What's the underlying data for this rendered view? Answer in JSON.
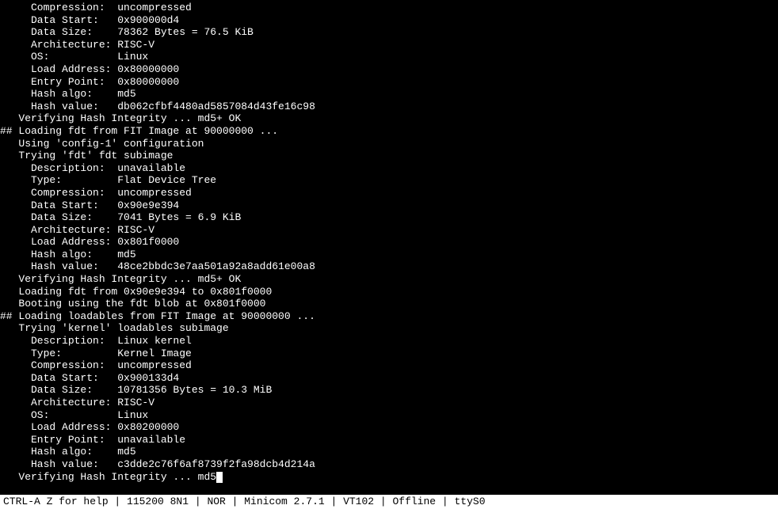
{
  "lines": [
    "     Compression:  uncompressed",
    "     Data Start:   0x900000d4",
    "     Data Size:    78362 Bytes = 76.5 KiB",
    "     Architecture: RISC-V",
    "     OS:           Linux",
    "     Load Address: 0x80000000",
    "     Entry Point:  0x80000000",
    "     Hash algo:    md5",
    "     Hash value:   db062cfbf4480ad5857084d43fe16c98",
    "   Verifying Hash Integrity ... md5+ OK",
    "## Loading fdt from FIT Image at 90000000 ...",
    "   Using 'config-1' configuration",
    "   Trying 'fdt' fdt subimage",
    "     Description:  unavailable",
    "     Type:         Flat Device Tree",
    "     Compression:  uncompressed",
    "     Data Start:   0x90e9e394",
    "     Data Size:    7041 Bytes = 6.9 KiB",
    "     Architecture: RISC-V",
    "     Load Address: 0x801f0000",
    "     Hash algo:    md5",
    "     Hash value:   48ce2bbdc3e7aa501a92a8add61e00a8",
    "   Verifying Hash Integrity ... md5+ OK",
    "   Loading fdt from 0x90e9e394 to 0x801f0000",
    "   Booting using the fdt blob at 0x801f0000",
    "## Loading loadables from FIT Image at 90000000 ...",
    "   Trying 'kernel' loadables subimage",
    "     Description:  Linux kernel",
    "     Type:         Kernel Image",
    "     Compression:  uncompressed",
    "     Data Start:   0x900133d4",
    "     Data Size:    10781356 Bytes = 10.3 MiB",
    "     Architecture: RISC-V",
    "     OS:           Linux",
    "     Load Address: 0x80200000",
    "     Entry Point:  unavailable",
    "     Hash algo:    md5",
    "     Hash value:   c3dde2c76f6af8739f2fa98dcb4d214a",
    "   Verifying Hash Integrity ... md5"
  ],
  "statusbar": "CTRL-A Z for help | 115200 8N1 | NOR | Minicom 2.7.1 | VT102 | Offline | ttyS0"
}
